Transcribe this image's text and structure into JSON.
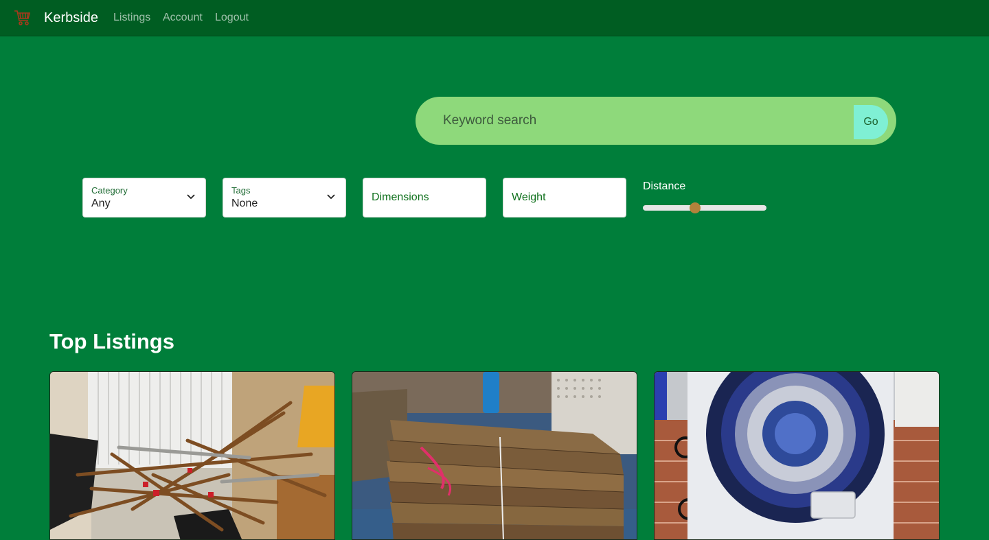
{
  "navbar": {
    "brand": "Kerbside",
    "logo_icon": "shopping-cart-icon",
    "links": [
      "Listings",
      "Account",
      "Logout"
    ]
  },
  "search": {
    "placeholder": "Keyword search",
    "go_label": "Go"
  },
  "filters": {
    "category": {
      "label": "Category",
      "value": "Any"
    },
    "tags": {
      "label": "Tags",
      "value": "None"
    },
    "dimensions": {
      "placeholder": "Dimensions"
    },
    "weight": {
      "placeholder": "Weight"
    },
    "distance": {
      "label": "Distance",
      "level": 0.42
    }
  },
  "top_listings": {
    "title": "Top Listings",
    "cards": [
      {
        "image": "scrap-copper-pipes-photo"
      },
      {
        "image": "stacked-timber-planks-photo"
      },
      {
        "image": "washing-machine-photo"
      }
    ]
  },
  "colors": {
    "page_bg": "#007e3a",
    "navbar_bg": "#005d22",
    "search_bg": "#8ed97b",
    "go_bg": "#7ff0d4",
    "slider_thumb": "#b3823b",
    "field_text": "#12721f"
  }
}
